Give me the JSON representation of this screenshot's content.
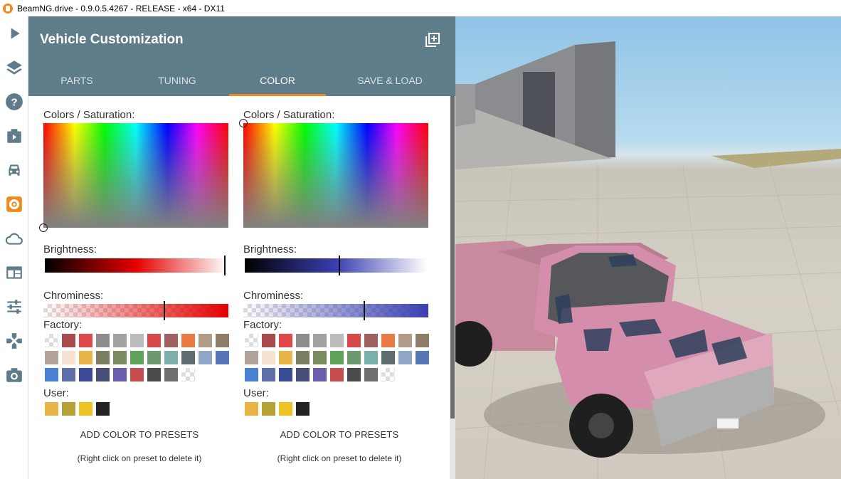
{
  "window": {
    "title": "BeamNG.drive - 0.9.0.5.4267 - RELEASE - x64 - DX11"
  },
  "sidebar": {
    "items": [
      {
        "icon": "play-icon"
      },
      {
        "icon": "layers-icon"
      },
      {
        "icon": "help-icon"
      },
      {
        "icon": "scenario-icon"
      },
      {
        "icon": "car-icon"
      },
      {
        "icon": "vehicle-config-icon",
        "active": true
      },
      {
        "icon": "cloud-icon"
      },
      {
        "icon": "ui-apps-icon"
      },
      {
        "icon": "options-icon"
      },
      {
        "icon": "controls-icon"
      },
      {
        "icon": "camera-icon"
      }
    ]
  },
  "panel": {
    "title": "Vehicle Customization",
    "tabs": [
      {
        "label": "PARTS"
      },
      {
        "label": "TUNING"
      },
      {
        "label": "COLOR",
        "active": true
      },
      {
        "label": "SAVE & LOAD"
      }
    ]
  },
  "color_pickers": [
    {
      "colors_label": "Colors / Saturation:",
      "brightness_label": "Brightness:",
      "brightness_value": 0.99,
      "chrominess_label": "Chrominess:",
      "chrominess_value": 0.65,
      "base_color": "#e30000",
      "factory_label": "Factory:",
      "user_label": "User:",
      "add_button": "ADD COLOR TO PRESETS",
      "hint": "(Right click on preset to delete it)"
    },
    {
      "colors_label": "Colors / Saturation:",
      "brightness_label": "Brightness:",
      "brightness_value": 0.52,
      "chrominess_label": "Chrominess:",
      "chrominess_value": 0.65,
      "base_color": "#3a3fb0",
      "factory_label": "Factory:",
      "user_label": "User:",
      "add_button": "ADD COLOR TO PRESETS",
      "hint": "(Right click on preset to delete it)"
    }
  ],
  "factory_colors": [
    "checker",
    "#a94b4d",
    "#e0484b",
    "#8c8c8c",
    "#a3a3a3",
    "#bcbcbc",
    "#d94848",
    "#a06060",
    "#ea7a43",
    "#b09a88",
    "#8e7c6a",
    "#b3a49b",
    "#f5e2d0",
    "#e8b548",
    "#7c7e61",
    "#7b8c62",
    "#5da45a",
    "#6c9a6c",
    "#7ab1aa",
    "#5e6c70",
    "#8fa8c8",
    "#5676b8",
    "#4a80d4",
    "#5f6fa7",
    "#3c4c96",
    "#474e7a",
    "#6a5cae",
    "#c64e4f",
    "#4b4b4b",
    "#707070",
    "checker"
  ],
  "user_colors": [
    "#e8b448",
    "#b6a135",
    "#edc421",
    "#232323"
  ],
  "accent_color": "#f08a1c",
  "header_color": "#5f7c8a"
}
